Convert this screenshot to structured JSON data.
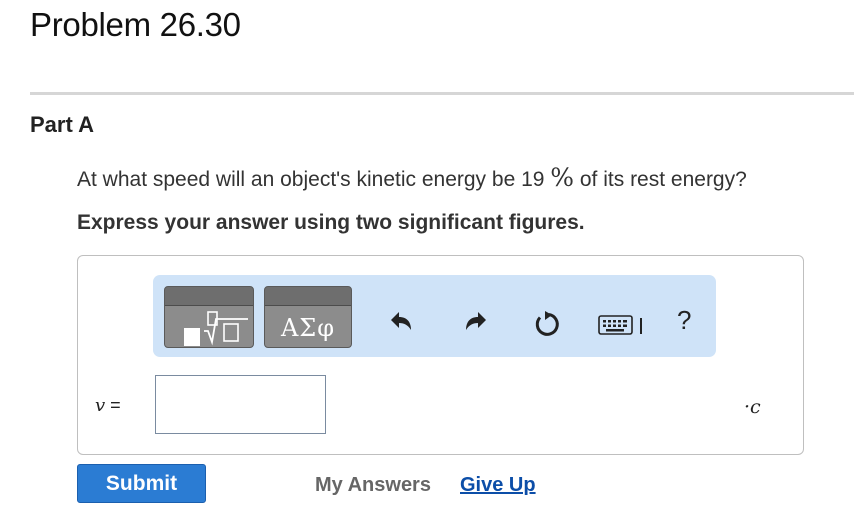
{
  "header": {
    "title": "Problem 26.30"
  },
  "part": {
    "title": "Part A"
  },
  "question": {
    "text_before": "At what speed will an object's kinetic energy be 19 ",
    "percent_symbol": "%",
    "text_after": " of its rest energy?",
    "instruction": "Express your answer using two significant figures."
  },
  "toolbar": {
    "templates_icon": "templates-sqrt-icon",
    "symbols_label": "ΑΣφ",
    "undo_icon": "undo-icon",
    "redo_icon": "redo-icon",
    "reset_icon": "reset-icon",
    "keyboard_icon": "keyboard-icon",
    "help_label": "?"
  },
  "answer": {
    "variable": "v",
    "equals": " =",
    "value": "",
    "unit_dot": "·",
    "unit": "c"
  },
  "actions": {
    "submit_label": "Submit",
    "my_answers_label": "My Answers",
    "give_up_label": "Give Up"
  },
  "colors": {
    "toolbar_bg": "#cfe3f8",
    "submit_bg": "#2b7cd3",
    "link": "#0c4ea8",
    "divider": "#d6d6d6"
  }
}
